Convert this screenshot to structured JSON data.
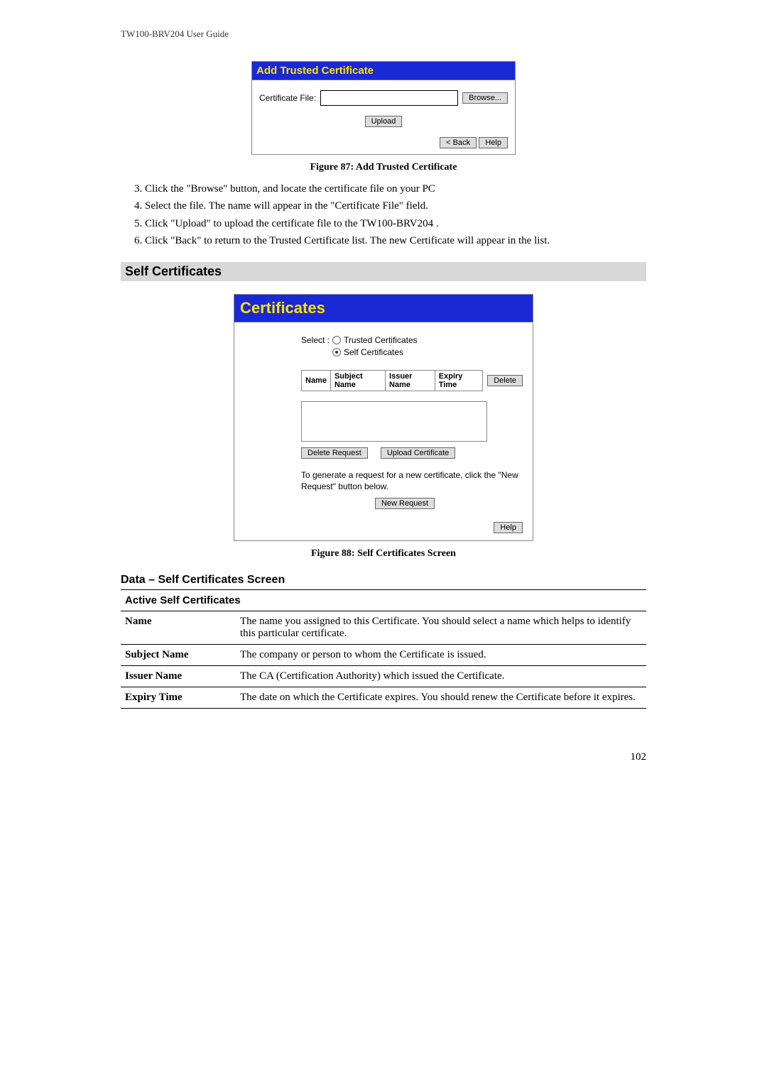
{
  "doc": {
    "header": "TW100-BRV204  User Guide",
    "page_number": "102"
  },
  "fig87": {
    "panel_title": "Add Trusted Certificate",
    "label_certfile": "Certificate File:",
    "btn_browse": "Browse...",
    "btn_upload": "Upload",
    "btn_back": "< Back",
    "btn_help": "Help",
    "caption": "Figure 87: Add Trusted Certificate"
  },
  "instructions": {
    "step3": "Click the \"Browse\" button, and locate the certificate file on your PC",
    "step4": "Select the file. The name will appear in the \"Certificate File\" field.",
    "step5": "Click \"Upload\" to upload the certificate file to the TW100-BRV204 .",
    "step6": "Click \"Back\" to return to the Trusted Certificate list. The new Certificate will appear in the list."
  },
  "section": {
    "self_certs": "Self Certificates"
  },
  "fig88": {
    "panel_title": "Certificates",
    "select_label": "Select :",
    "opt_trusted": "Trusted Certificates",
    "opt_self": "Self Certificates",
    "col_name": "Name",
    "col_subject": "Subject Name",
    "col_issuer": "Issuer Name",
    "col_expiry": "Expiry Time",
    "btn_delete": "Delete",
    "btn_delete_req": "Delete Request",
    "btn_upload_cert": "Upload Certificate",
    "gen_text": "To generate a request for a new certificate, click the \"New Request\" button below.",
    "btn_new_request": "New Request",
    "btn_help": "Help",
    "caption": "Figure 88: Self Certificates Screen"
  },
  "data_table": {
    "heading": "Data – Self Certificates Screen",
    "group": "Active Self Certificates",
    "rows": [
      {
        "label": "Name",
        "desc": "The name you assigned to this Certificate. You should select a name which helps to identify this particular certificate."
      },
      {
        "label": "Subject Name",
        "desc": "The company or person to whom the Certificate is issued."
      },
      {
        "label": "Issuer Name",
        "desc": "The CA (Certification Authority) which issued the Certificate."
      },
      {
        "label": "Expiry Time",
        "desc": "The date on which the Certificate expires. You should renew the Certificate before it expires."
      }
    ]
  }
}
